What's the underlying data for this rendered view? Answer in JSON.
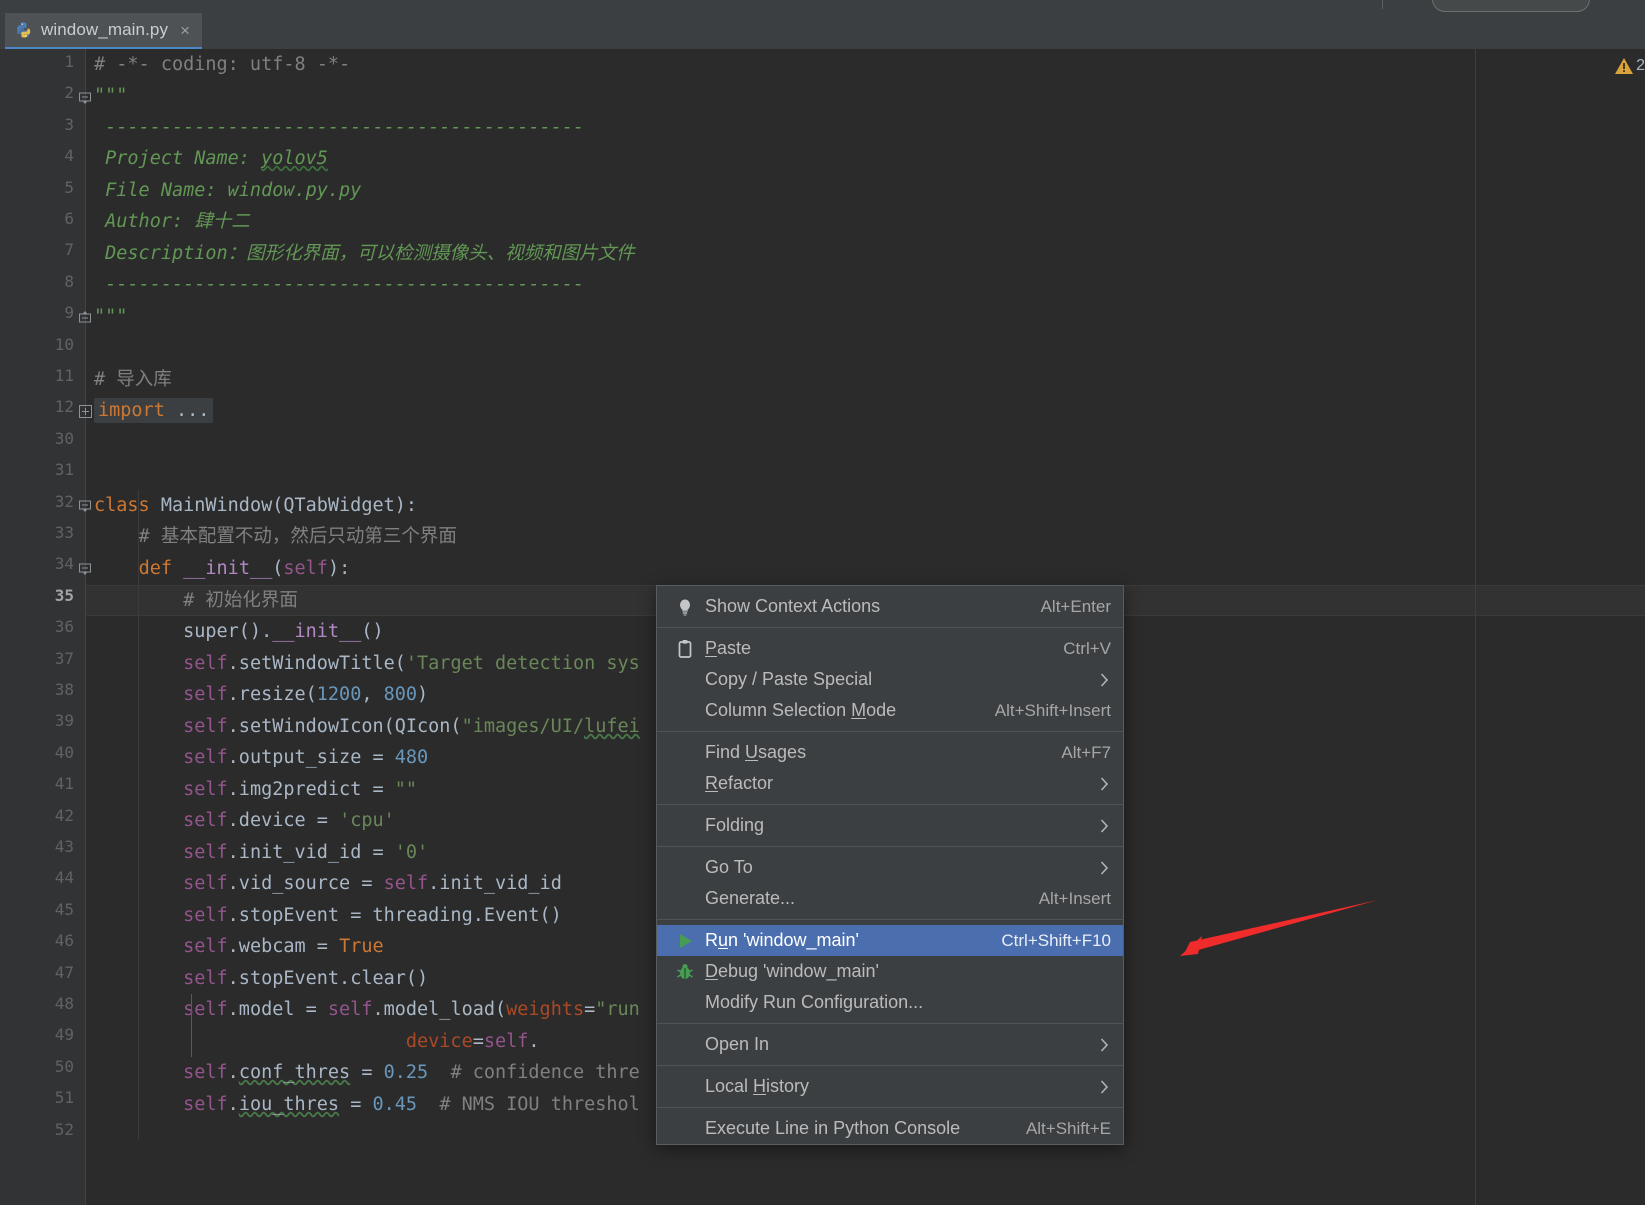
{
  "window": {
    "app": "PyCharm",
    "tab": {
      "label": "window_main.py",
      "icon": "python-file-icon",
      "close": "×"
    },
    "search_pill_placeholder": ""
  },
  "editor": {
    "warning_badge": {
      "icon": "warning-triangle-icon",
      "count": "2",
      "color": "#d9a23a"
    },
    "line_numbers": [
      "1",
      "2",
      "3",
      "4",
      "5",
      "6",
      "7",
      "8",
      "9",
      "10",
      "11",
      "12",
      "30",
      "31",
      "32",
      "33",
      "34",
      "35",
      "36",
      "37",
      "38",
      "39",
      "40",
      "41",
      "42",
      "43",
      "44",
      "45",
      "46",
      "47",
      "48",
      "49",
      "50",
      "51",
      "52"
    ],
    "current_line": "35",
    "lines": [
      {
        "n": "1",
        "text": "# -*- coding: utf-8 -*-"
      },
      {
        "n": "2",
        "text": "\"\"\""
      },
      {
        "n": "3",
        "text": "-------------------------------------------"
      },
      {
        "n": "4",
        "text": "Project Name: yolov5"
      },
      {
        "n": "5",
        "text": "File Name: window.py.py"
      },
      {
        "n": "6",
        "text": "Author: 肆十二"
      },
      {
        "n": "7",
        "text": "Description：图形化界面，可以检测摄像头、视频和图片文件"
      },
      {
        "n": "8",
        "text": "-------------------------------------------"
      },
      {
        "n": "9",
        "text": "\"\"\""
      },
      {
        "n": "10",
        "text": ""
      },
      {
        "n": "11",
        "text": "# 导入库"
      },
      {
        "n": "12",
        "text": "import ..."
      },
      {
        "n": "30",
        "text": ""
      },
      {
        "n": "31",
        "text": ""
      },
      {
        "n": "32",
        "text": "class MainWindow(QTabWidget):"
      },
      {
        "n": "33",
        "text": "    # 基本配置不动，然后只动第三个界面"
      },
      {
        "n": "34",
        "text": "    def __init__(self):"
      },
      {
        "n": "35",
        "text": "        # 初始化界面"
      },
      {
        "n": "36",
        "text": "        super().__init__()"
      },
      {
        "n": "37",
        "text": "        self.setWindowTitle('Target detection sys"
      },
      {
        "n": "38",
        "text": "        self.resize(1200, 800)"
      },
      {
        "n": "39",
        "text": "        self.setWindowIcon(QIcon(\"images/UI/lufei"
      },
      {
        "n": "40",
        "text": "        self.output_size = 480"
      },
      {
        "n": "41",
        "text": "        self.img2predict = \"\""
      },
      {
        "n": "42",
        "text": "        self.device = 'cpu'"
      },
      {
        "n": "43",
        "text": "        self.init_vid_id = '0'"
      },
      {
        "n": "44",
        "text": "        self.vid_source = self.init_vid_id"
      },
      {
        "n": "45",
        "text": "        self.stopEvent = threading.Event()"
      },
      {
        "n": "46",
        "text": "        self.webcam = True"
      },
      {
        "n": "47",
        "text": "        self.stopEvent.clear()"
      },
      {
        "n": "48",
        "text": "        self.model = self.model_load(weights=\"run"
      },
      {
        "n": "49",
        "text": "                            device=self."
      },
      {
        "n": "50",
        "text": "        self.conf_thres = 0.25  # confidence thre"
      },
      {
        "n": "51",
        "text": "        self.iou_thres = 0.45  # NMS IOU threshol"
      },
      {
        "n": "52",
        "text": ""
      }
    ]
  },
  "context_menu": {
    "groups": [
      {
        "items": [
          {
            "label": "Show Context Actions",
            "shortcut": "Alt+Enter",
            "icon": "lightbulb-icon",
            "mnemonic": "",
            "submenu": false,
            "selected": false
          }
        ]
      },
      {
        "items": [
          {
            "label": "Paste",
            "shortcut": "Ctrl+V",
            "icon": "clipboard-icon",
            "mnemonic": "P",
            "submenu": false,
            "selected": false
          },
          {
            "label": "Copy / Paste Special",
            "shortcut": "",
            "icon": "",
            "mnemonic": "",
            "submenu": true,
            "selected": false
          },
          {
            "label": "Column Selection Mode",
            "shortcut": "Alt+Shift+Insert",
            "icon": "",
            "mnemonic": "M",
            "submenu": false,
            "selected": false
          }
        ]
      },
      {
        "items": [
          {
            "label": "Find Usages",
            "shortcut": "Alt+F7",
            "icon": "",
            "mnemonic": "U",
            "submenu": false,
            "selected": false
          },
          {
            "label": "Refactor",
            "shortcut": "",
            "icon": "",
            "mnemonic": "R",
            "submenu": true,
            "selected": false
          }
        ]
      },
      {
        "items": [
          {
            "label": "Folding",
            "shortcut": "",
            "icon": "",
            "mnemonic": "",
            "submenu": true,
            "selected": false
          }
        ]
      },
      {
        "items": [
          {
            "label": "Go To",
            "shortcut": "",
            "icon": "",
            "mnemonic": "",
            "submenu": true,
            "selected": false
          },
          {
            "label": "Generate...",
            "shortcut": "Alt+Insert",
            "icon": "",
            "mnemonic": "",
            "submenu": false,
            "selected": false
          }
        ]
      },
      {
        "items": [
          {
            "label": "Run 'window_main'",
            "shortcut": "Ctrl+Shift+F10",
            "icon": "run-play-icon",
            "mnemonic": "u",
            "submenu": false,
            "selected": true
          },
          {
            "label": "Debug 'window_main'",
            "shortcut": "",
            "icon": "debug-bug-icon",
            "mnemonic": "D",
            "submenu": false,
            "selected": false
          },
          {
            "label": "Modify Run Configuration...",
            "shortcut": "",
            "icon": "",
            "mnemonic": "",
            "submenu": false,
            "selected": false
          }
        ]
      },
      {
        "items": [
          {
            "label": "Open In",
            "shortcut": "",
            "icon": "",
            "mnemonic": "",
            "submenu": true,
            "selected": false
          }
        ]
      },
      {
        "items": [
          {
            "label": "Local History",
            "shortcut": "",
            "icon": "",
            "mnemonic": "H",
            "submenu": true,
            "selected": false
          }
        ]
      },
      {
        "items": [
          {
            "label": "Execute Line in Python Console",
            "shortcut": "Alt+Shift+E",
            "icon": "",
            "mnemonic": "",
            "submenu": false,
            "selected": false
          }
        ]
      }
    ]
  },
  "annotation": {
    "arrow_color": "#ef2b2b",
    "name": "red-pointer-arrow"
  },
  "colors": {
    "editor_bg": "#2b2b2b",
    "gutter_bg": "#313335",
    "chrome_bg": "#3c3f41",
    "menu_bg": "#3c3f41",
    "selection_blue": "#4b6eaf",
    "tab_active": "#4e5254",
    "tab_underline": "#4a88c7",
    "warning_yellow": "#d9a23a"
  }
}
